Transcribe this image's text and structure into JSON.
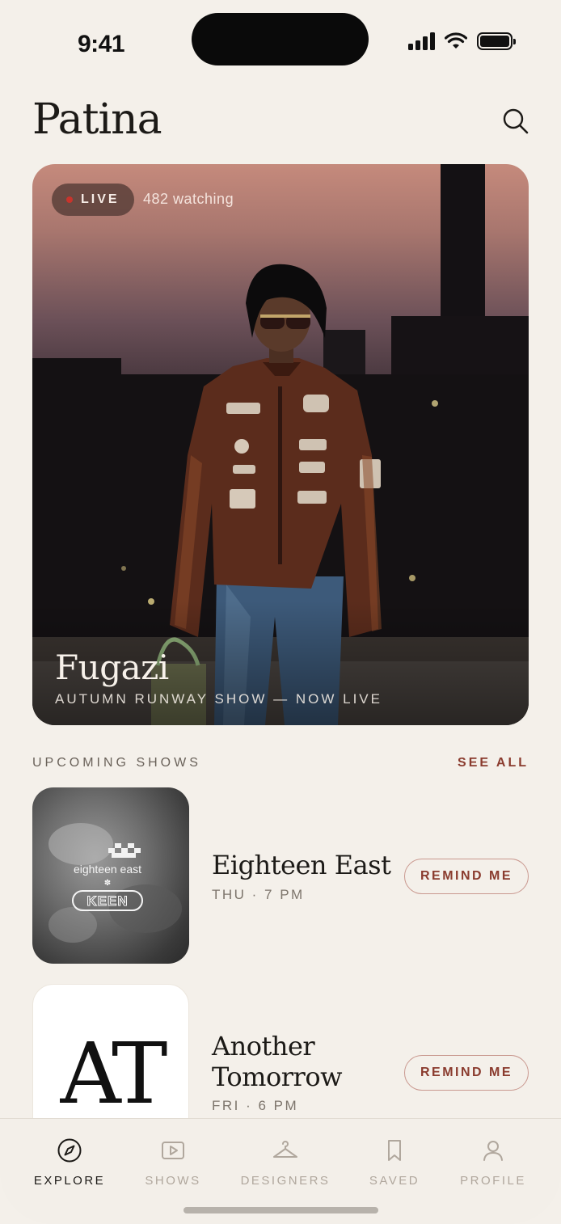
{
  "status_bar": {
    "time": "9:41"
  },
  "header": {
    "brand": "Patina"
  },
  "hero": {
    "live_label": "LIVE",
    "watching": "482 watching",
    "title": "Fugazi",
    "subtitle": "AUTUMN RUNWAY SHOW — NOW LIVE"
  },
  "upcoming": {
    "section_title": "UPCOMING SHOWS",
    "see_all": "SEE ALL",
    "shows": [
      {
        "name": "Eighteen East",
        "time": "THU · 7 PM",
        "remind": "REMIND ME",
        "logo_text_1": "eighteen east",
        "logo_text_2": "KEEN"
      },
      {
        "name_line1": "Another",
        "name_line2": "Tomorrow",
        "time": "FRI · 6 PM",
        "remind": "REMIND ME",
        "logo_text": "AT"
      }
    ]
  },
  "tabs": [
    {
      "label": "EXPLORE",
      "icon": "compass-icon",
      "active": true
    },
    {
      "label": "SHOWS",
      "icon": "play-icon",
      "active": false
    },
    {
      "label": "DESIGNERS",
      "icon": "hanger-icon",
      "active": false
    },
    {
      "label": "SAVED",
      "icon": "bookmark-icon",
      "active": false
    },
    {
      "label": "PROFILE",
      "icon": "user-icon",
      "active": false
    }
  ],
  "colors": {
    "accent": "#8a3b2e",
    "background": "#f4f0ea",
    "live_dot": "#c8342c"
  }
}
